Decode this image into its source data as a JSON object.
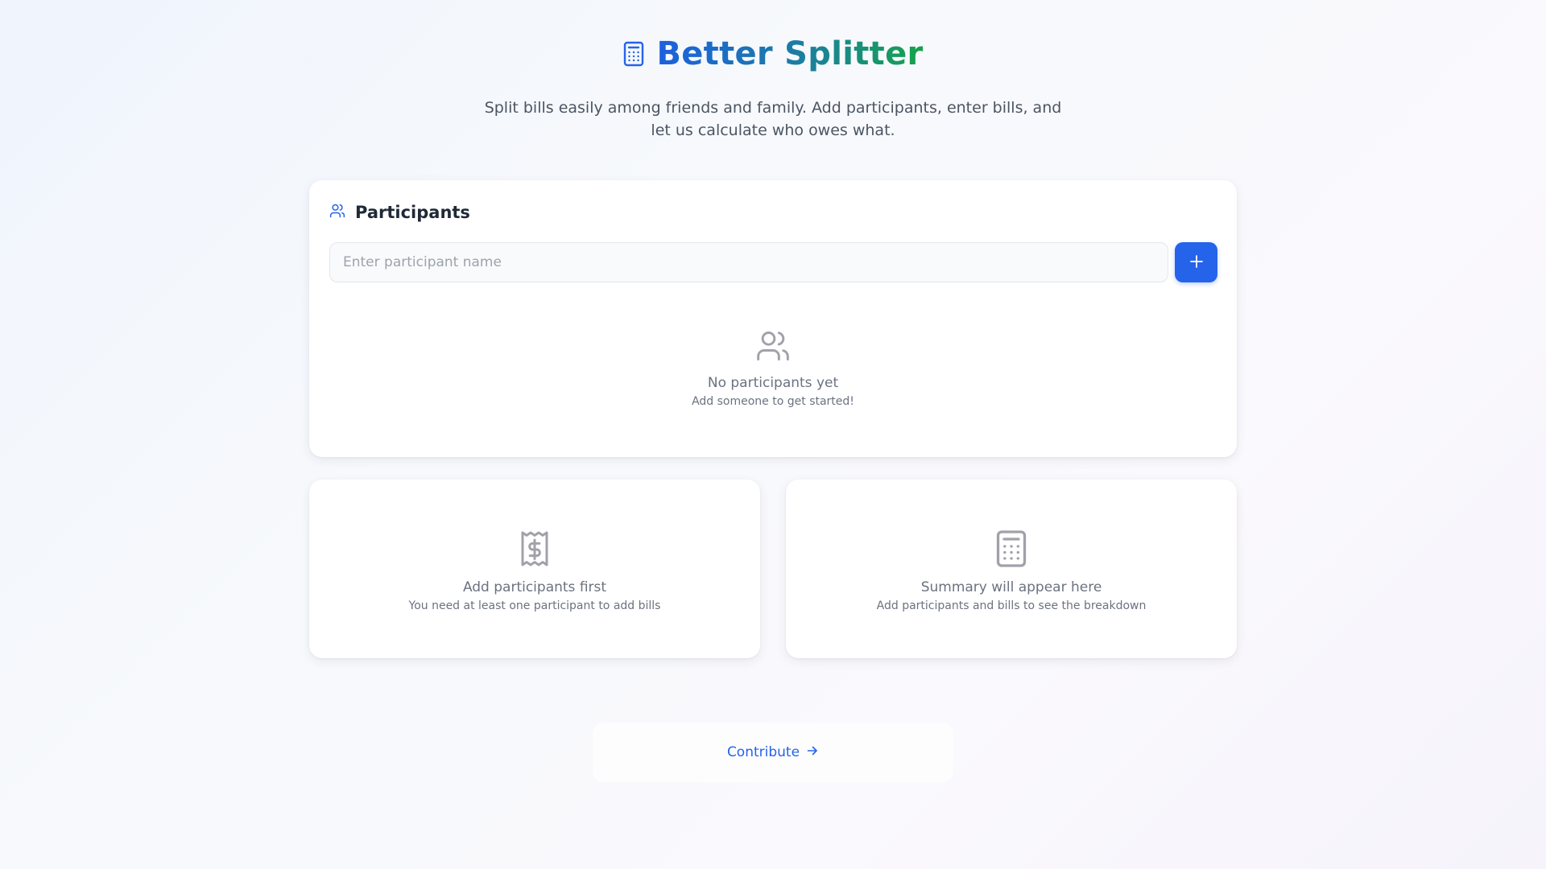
{
  "app": {
    "title": "Better Splitter",
    "subtitle": "Split bills easily among friends and family. Add participants, enter bills, and let us calculate who owes what.",
    "icon": "calculator-icon"
  },
  "participants": {
    "heading": "Participants",
    "icon": "users-icon",
    "input_placeholder": "Enter participant name",
    "input_value": "",
    "add_button_icon": "plus-icon",
    "empty_title": "No participants yet",
    "empty_subtitle": "Add someone to get started!"
  },
  "bills": {
    "icon": "receipt-icon",
    "empty_title": "Add participants first",
    "empty_subtitle": "You need at least one participant to add bills"
  },
  "summary": {
    "icon": "calculator-icon",
    "empty_title": "Summary will appear here",
    "empty_subtitle": "Add participants and bills to see the breakdown"
  },
  "footer": {
    "contribute_label": "Contribute",
    "contribute_icon": "arrow-right-icon"
  },
  "colors": {
    "accent": "#2563eb",
    "title_gradient_start": "#1d5fe0",
    "title_gradient_end": "#16a34a",
    "muted_icon": "#a1a1aa"
  }
}
